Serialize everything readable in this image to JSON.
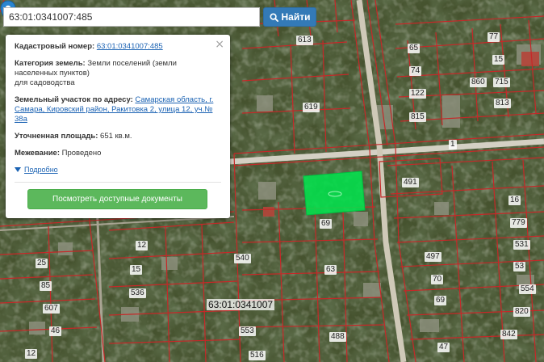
{
  "search": {
    "value": "63:01:0341007:485",
    "button_label": "Найти",
    "button_icon": "search-icon"
  },
  "popup": {
    "close_label": "×",
    "cadastral_label": "Кадастровый номер:",
    "cadastral_number": "63:01:0341007:485",
    "category_label": "Категория земель:",
    "category_value": "Земли поселений (земли населенных пунктов)",
    "category_value_2": "для садоводства",
    "address_label": "Земельный участок по адресу:",
    "address_value": "Самарская область, г. Самара, Кировский район, Ракитовка 2, улица 12, уч.№ 38а",
    "area_label": "Уточненная площадь:",
    "area_value": "651 кв.м.",
    "survey_label": "Межевание:",
    "survey_value": "Проведено",
    "details_link": "Подробно",
    "docs_button": "Посмотреть доступные документы"
  },
  "map": {
    "quarter_label": "63:01:0341007",
    "highlight_color": "#00e64d",
    "marker_color": "#2a85d0",
    "boundary_color": "#c62828",
    "plot_labels": [
      "613",
      "77",
      "65",
      "15",
      "74",
      "860",
      "715",
      "122",
      "619",
      "813",
      "815",
      "1",
      "491",
      "16",
      "69",
      "779",
      "12",
      "531",
      "540",
      "497",
      "25",
      "15",
      "63",
      "70",
      "53",
      "536",
      "85",
      "554",
      "607",
      "69",
      "820",
      "46",
      "553",
      "488",
      "842",
      "12",
      "516",
      "47"
    ]
  }
}
